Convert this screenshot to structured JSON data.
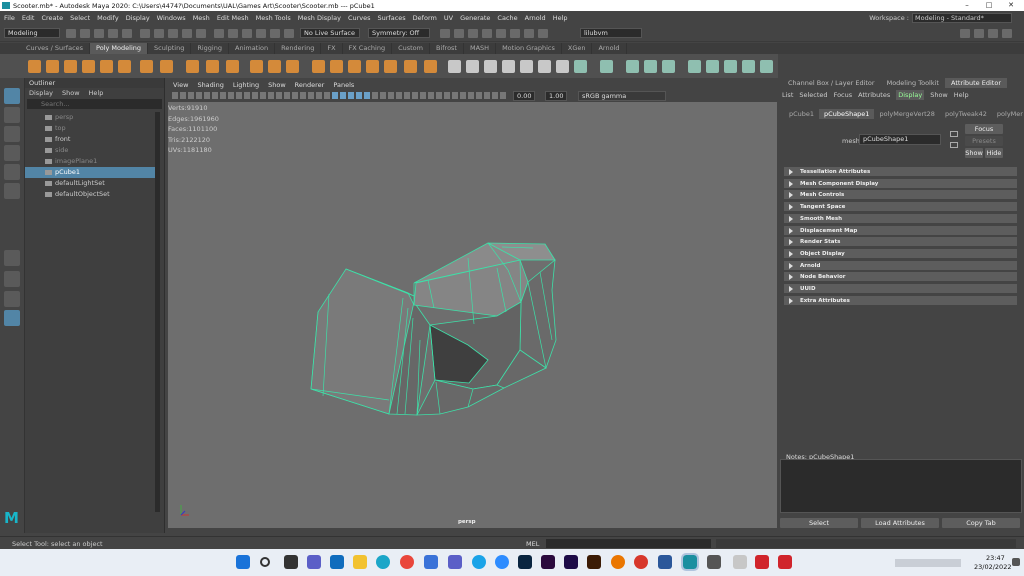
{
  "window": {
    "title": "Scooter.mb* - Autodesk Maya 2020: C:\\Users\\4474?\\Documents\\UAL\\Games Art\\Scooter\\Scooter.mb  ---  pCube1"
  },
  "menubar": {
    "items": [
      "File",
      "Edit",
      "Create",
      "Select",
      "Modify",
      "Display",
      "Windows",
      "Mesh",
      "Edit Mesh",
      "Mesh Tools",
      "Mesh Display",
      "Curves",
      "Surfaces",
      "Deform",
      "UV",
      "Generate",
      "Cache",
      "Arnold",
      "Help"
    ]
  },
  "workspace": {
    "label": "Workspace :",
    "value": "Modeling - Standard*"
  },
  "status": {
    "mode": "Modeling",
    "live": "No Live Surface",
    "symmetry": "Symmetry: Off",
    "user": "lilubvm"
  },
  "shelf_tabs": [
    "Curves / Surfaces",
    "Poly Modeling",
    "Sculpting",
    "Rigging",
    "Animation",
    "Rendering",
    "FX",
    "FX Caching",
    "Custom",
    "Bifrost",
    "MASH",
    "Motion Graphics",
    "XGen",
    "Arnold"
  ],
  "outliner": {
    "title": "Outliner",
    "menu": [
      "Display",
      "Show",
      "Help"
    ],
    "search_placeholder": "Search...",
    "items": [
      {
        "label": "persp",
        "dim": true
      },
      {
        "label": "top",
        "dim": true
      },
      {
        "label": "front",
        "dim": false
      },
      {
        "label": "side",
        "dim": true
      },
      {
        "label": "imagePlane1",
        "dim": true
      },
      {
        "label": "pCube1",
        "selected": true
      },
      {
        "label": "defaultLightSet",
        "dim": false
      },
      {
        "label": "defaultObjectSet",
        "dim": false
      }
    ]
  },
  "viewport": {
    "menu": [
      "View",
      "Shading",
      "Lighting",
      "Show",
      "Renderer",
      "Panels"
    ],
    "exposure": "0.00",
    "gamma": "1.00",
    "colorspace": "sRGB gamma",
    "camera": "persp",
    "hud": [
      {
        "label": "Verts:",
        "a": "91",
        "b": "91",
        "c": "0"
      },
      {
        "label": "Edges:",
        "a": "196",
        "b": "196",
        "c": "0"
      },
      {
        "label": "Faces:",
        "a": "110",
        "b": "110",
        "c": "0"
      },
      {
        "label": "Tris:",
        "a": "212",
        "b": "212",
        "c": "0"
      },
      {
        "label": "UVs:",
        "a": "118",
        "b": "118",
        "c": "0"
      }
    ]
  },
  "right_panel": {
    "tabs": [
      "Channel Box / Layer Editor",
      "Modeling Toolkit",
      "Attribute Editor"
    ],
    "menu": [
      "List",
      "Selected",
      "Focus",
      "Attributes",
      "Display",
      "Show",
      "Help"
    ],
    "node_tabs": [
      "pCube1",
      "pCubeShape1",
      "polyMergeVert28",
      "polyTweak42",
      "polyMer"
    ],
    "mesh_label": "mesh:",
    "mesh_value": "pCubeShape1",
    "focus": "Focus",
    "presets": "Presets",
    "show": "Show",
    "hide": "Hide",
    "sections": [
      "Tessellation Attributes",
      "Mesh Component Display",
      "Mesh Controls",
      "Tangent Space",
      "Smooth Mesh",
      "Displacement Map",
      "Render Stats",
      "Object Display",
      "Arnold",
      "Node Behavior",
      "UUID",
      "Extra Attributes"
    ],
    "notes": "Notes:  pCubeShape1",
    "buttons": [
      "Select",
      "Load Attributes",
      "Copy Tab"
    ]
  },
  "cmdline": {
    "help": "Select Tool: select an object",
    "lang": "MEL"
  },
  "taskbar": {
    "time": "23:47",
    "date": "23/02/2022"
  }
}
